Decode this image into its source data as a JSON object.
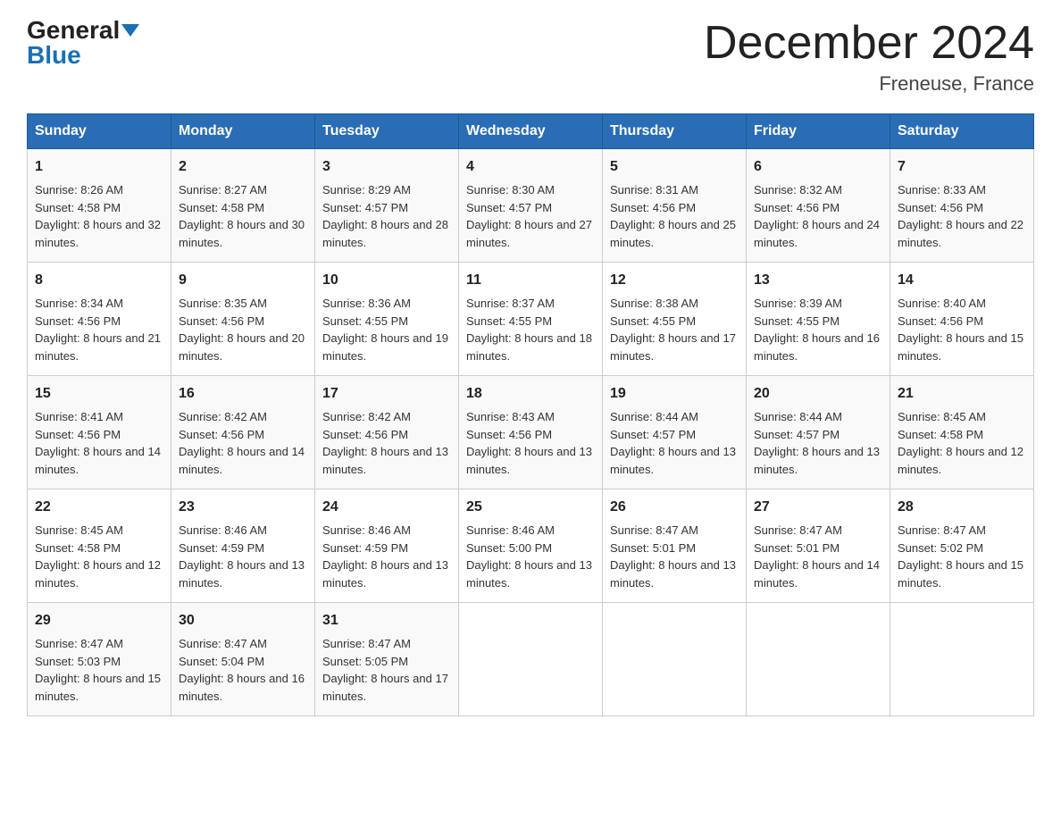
{
  "header": {
    "logo_general": "General",
    "logo_blue": "Blue",
    "month_title": "December 2024",
    "location": "Freneuse, France"
  },
  "weekdays": [
    "Sunday",
    "Monday",
    "Tuesday",
    "Wednesday",
    "Thursday",
    "Friday",
    "Saturday"
  ],
  "weeks": [
    [
      {
        "day": 1,
        "sunrise": "8:26 AM",
        "sunset": "4:58 PM",
        "daylight": "8 hours and 32 minutes."
      },
      {
        "day": 2,
        "sunrise": "8:27 AM",
        "sunset": "4:58 PM",
        "daylight": "8 hours and 30 minutes."
      },
      {
        "day": 3,
        "sunrise": "8:29 AM",
        "sunset": "4:57 PM",
        "daylight": "8 hours and 28 minutes."
      },
      {
        "day": 4,
        "sunrise": "8:30 AM",
        "sunset": "4:57 PM",
        "daylight": "8 hours and 27 minutes."
      },
      {
        "day": 5,
        "sunrise": "8:31 AM",
        "sunset": "4:56 PM",
        "daylight": "8 hours and 25 minutes."
      },
      {
        "day": 6,
        "sunrise": "8:32 AM",
        "sunset": "4:56 PM",
        "daylight": "8 hours and 24 minutes."
      },
      {
        "day": 7,
        "sunrise": "8:33 AM",
        "sunset": "4:56 PM",
        "daylight": "8 hours and 22 minutes."
      }
    ],
    [
      {
        "day": 8,
        "sunrise": "8:34 AM",
        "sunset": "4:56 PM",
        "daylight": "8 hours and 21 minutes."
      },
      {
        "day": 9,
        "sunrise": "8:35 AM",
        "sunset": "4:56 PM",
        "daylight": "8 hours and 20 minutes."
      },
      {
        "day": 10,
        "sunrise": "8:36 AM",
        "sunset": "4:55 PM",
        "daylight": "8 hours and 19 minutes."
      },
      {
        "day": 11,
        "sunrise": "8:37 AM",
        "sunset": "4:55 PM",
        "daylight": "8 hours and 18 minutes."
      },
      {
        "day": 12,
        "sunrise": "8:38 AM",
        "sunset": "4:55 PM",
        "daylight": "8 hours and 17 minutes."
      },
      {
        "day": 13,
        "sunrise": "8:39 AM",
        "sunset": "4:55 PM",
        "daylight": "8 hours and 16 minutes."
      },
      {
        "day": 14,
        "sunrise": "8:40 AM",
        "sunset": "4:56 PM",
        "daylight": "8 hours and 15 minutes."
      }
    ],
    [
      {
        "day": 15,
        "sunrise": "8:41 AM",
        "sunset": "4:56 PM",
        "daylight": "8 hours and 14 minutes."
      },
      {
        "day": 16,
        "sunrise": "8:42 AM",
        "sunset": "4:56 PM",
        "daylight": "8 hours and 14 minutes."
      },
      {
        "day": 17,
        "sunrise": "8:42 AM",
        "sunset": "4:56 PM",
        "daylight": "8 hours and 13 minutes."
      },
      {
        "day": 18,
        "sunrise": "8:43 AM",
        "sunset": "4:56 PM",
        "daylight": "8 hours and 13 minutes."
      },
      {
        "day": 19,
        "sunrise": "8:44 AM",
        "sunset": "4:57 PM",
        "daylight": "8 hours and 13 minutes."
      },
      {
        "day": 20,
        "sunrise": "8:44 AM",
        "sunset": "4:57 PM",
        "daylight": "8 hours and 13 minutes."
      },
      {
        "day": 21,
        "sunrise": "8:45 AM",
        "sunset": "4:58 PM",
        "daylight": "8 hours and 12 minutes."
      }
    ],
    [
      {
        "day": 22,
        "sunrise": "8:45 AM",
        "sunset": "4:58 PM",
        "daylight": "8 hours and 12 minutes."
      },
      {
        "day": 23,
        "sunrise": "8:46 AM",
        "sunset": "4:59 PM",
        "daylight": "8 hours and 13 minutes."
      },
      {
        "day": 24,
        "sunrise": "8:46 AM",
        "sunset": "4:59 PM",
        "daylight": "8 hours and 13 minutes."
      },
      {
        "day": 25,
        "sunrise": "8:46 AM",
        "sunset": "5:00 PM",
        "daylight": "8 hours and 13 minutes."
      },
      {
        "day": 26,
        "sunrise": "8:47 AM",
        "sunset": "5:01 PM",
        "daylight": "8 hours and 13 minutes."
      },
      {
        "day": 27,
        "sunrise": "8:47 AM",
        "sunset": "5:01 PM",
        "daylight": "8 hours and 14 minutes."
      },
      {
        "day": 28,
        "sunrise": "8:47 AM",
        "sunset": "5:02 PM",
        "daylight": "8 hours and 15 minutes."
      }
    ],
    [
      {
        "day": 29,
        "sunrise": "8:47 AM",
        "sunset": "5:03 PM",
        "daylight": "8 hours and 15 minutes."
      },
      {
        "day": 30,
        "sunrise": "8:47 AM",
        "sunset": "5:04 PM",
        "daylight": "8 hours and 16 minutes."
      },
      {
        "day": 31,
        "sunrise": "8:47 AM",
        "sunset": "5:05 PM",
        "daylight": "8 hours and 17 minutes."
      },
      null,
      null,
      null,
      null
    ]
  ]
}
